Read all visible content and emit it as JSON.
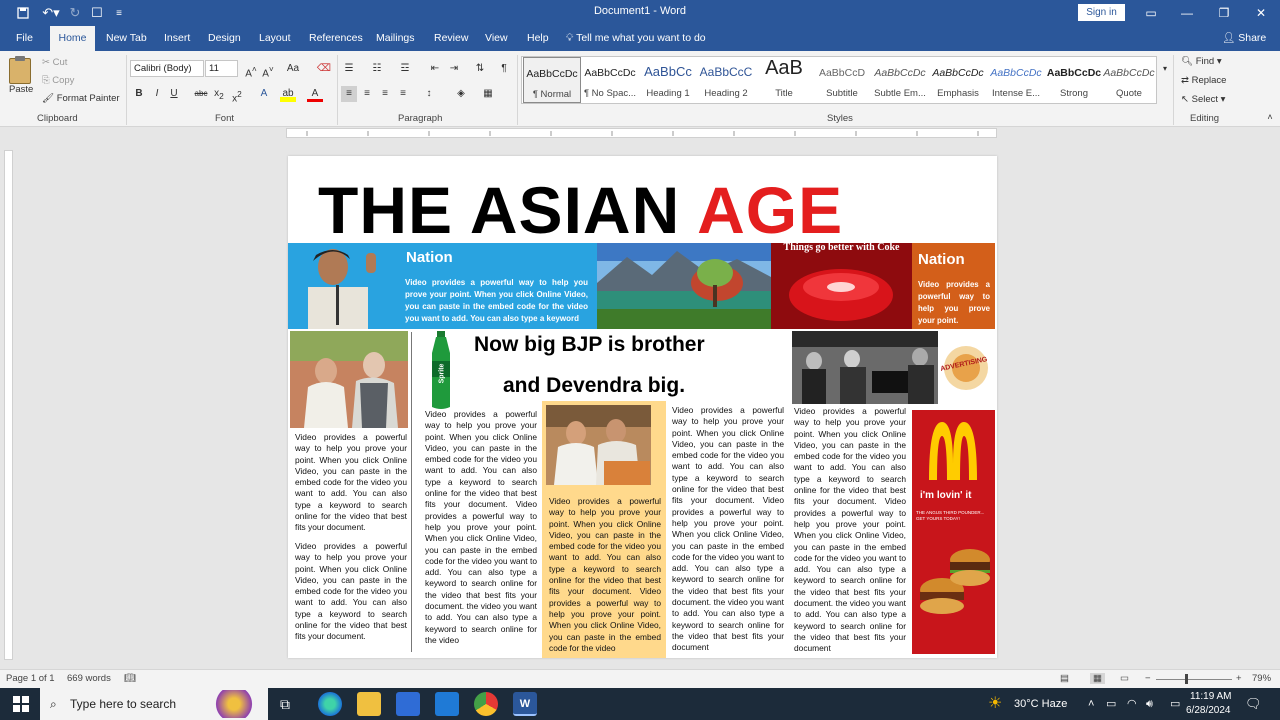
{
  "title_bar": {
    "title": "Document1 - Word",
    "sign_in": "Sign in"
  },
  "tabs": [
    "File",
    "Home",
    "New Tab",
    "Insert",
    "Design",
    "Layout",
    "References",
    "Mailings",
    "Review",
    "View",
    "Help"
  ],
  "tell_me": "Tell me what you want to do",
  "share": "Share",
  "clipboard": {
    "paste": "Paste",
    "cut": "Cut",
    "copy": "Copy",
    "format_painter": "Format Painter",
    "label": "Clipboard"
  },
  "font": {
    "name": "Calibri (Body)",
    "size": "11",
    "label": "Font",
    "case_btn": "Aa"
  },
  "paragraph": {
    "label": "Paragraph"
  },
  "styles": {
    "label": "Styles",
    "items": [
      {
        "sample": "AaBbCcDc",
        "name": "¶ Normal"
      },
      {
        "sample": "AaBbCcDc",
        "name": "¶ No Spac..."
      },
      {
        "sample": "AaBbCc",
        "name": "Heading 1"
      },
      {
        "sample": "AaBbCcC",
        "name": "Heading 2"
      },
      {
        "sample": "AaB",
        "name": "Title"
      },
      {
        "sample": "AaBbCcD",
        "name": "Subtitle"
      },
      {
        "sample": "AaBbCcDc",
        "name": "Subtle Em..."
      },
      {
        "sample": "AaBbCcDc",
        "name": "Emphasis"
      },
      {
        "sample": "AaBbCcDc",
        "name": "Intense E..."
      },
      {
        "sample": "AaBbCcDc",
        "name": "Strong"
      },
      {
        "sample": "AaBbCcDc",
        "name": "Quote"
      }
    ]
  },
  "editing": {
    "find": "Find",
    "replace": "Replace",
    "select": "Select",
    "label": "Editing"
  },
  "document": {
    "masthead_black": "THE ASIAN ",
    "masthead_red": "AGE",
    "nation_head_1": "Nation",
    "nation_text_1": "Video provides a powerful way to help you prove your point. When you click Online Video, you can paste in the embed code for the video you want to add. You can also type a keyword",
    "coke_banner": "Things go better with Coke",
    "nation_head_2": "Nation",
    "nation_text_2": "Video provides a powerful way to help you prove your point.",
    "headline_1": "Now big BJP is brother",
    "headline_2": "and Devendra big.",
    "col1_text_a": "Video provides a powerful way to help you prove your point. When you click Online Video, you can paste in the embed code for the video you want to add. You can also type a keyword to search online for the video that best fits your document.",
    "col1_text_b": "Video provides a powerful way to help you prove your point. When you click Online Video, you can paste in the embed code for the video you want to add. You can also type a keyword to search online for the video that best fits your document.",
    "col2_text": "Video provides a powerful way to help you prove your point. When you click Online Video, you can paste in the embed code for the video you want to add. You can also type a keyword to search online for the video that best fits your document. Video provides a powerful way to help you prove your point. When you click Online Video, you can paste in the embed code for the video you want to add. You can also type a keyword to search online for the video that best fits your document. the video you want to add. You can also type a keyword to search online for the video",
    "col3_text": "Video provides a powerful way to help you prove your point. When you click Online Video, you can paste in the embed code for the video you want to add. You can also type a keyword to search online for the video that best fits your document. Video provides a powerful way to help you prove your point. When you click Online Video, you can paste in the embed code for the video",
    "col4_text": "Video provides a powerful way to help you prove your point. When you click Online Video, you can paste in the embed code for the video you want to add. You can also type a keyword to search online for the video that best fits your document. Video provides a powerful way to help you prove your point. When you click Online Video, you can paste in the embed code for the video you want to add. You can also type a keyword to search online for the video that best fits your document. the video you want to add. You can also type a keyword to search online for the video that best fits your document",
    "col5_text": "Video provides a powerful way to help you prove your point. When you click Online Video, you can paste in the embed code for the video you want to add. You can also type a keyword to search online for the video that best fits your document. Video provides a powerful way to help you prove your point. When you click Online Video, you can paste in the embed code for the video you want to add. You can also type a keyword to search online for the video that best fits your document. the video you want to add. You can also type a keyword to search online for the video that best fits your document",
    "ad_advertising": "ADVERTISING",
    "ad_mcd_slogan": "i'm lovin' it",
    "ad_mcd_tag": "THE ANGUS THIRD POUNDER... GET YOURS TODAY!",
    "sprite_label": "Sprite"
  },
  "status": {
    "page": "Page 1 of 1",
    "words": "669 words",
    "zoom": "79%"
  },
  "taskbar": {
    "search": "Type here to search",
    "weather": "30°C  Haze",
    "time": "11:19 AM",
    "date": "6/28/2024"
  },
  "colors": {
    "word_blue": "#2b579a",
    "nation_blue": "#29a3e0",
    "nation_orange": "#d35f1a",
    "masthead_red": "#e41e1e",
    "highlight_yellow": "#ffd98c"
  }
}
